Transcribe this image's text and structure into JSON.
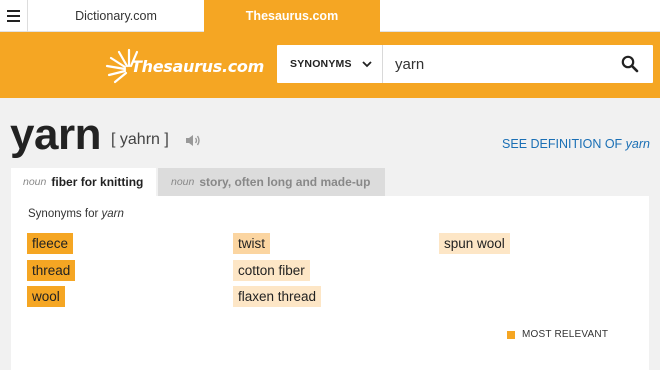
{
  "top_tabs": {
    "dictionary": "Dictionary.com",
    "thesaurus": "Thesaurus.com"
  },
  "logo": {
    "text": "Thesaurus.com"
  },
  "search": {
    "mode_label": "SYNONYMS",
    "query": "yarn"
  },
  "entry": {
    "word": "yarn",
    "pronunciation": "[ yahrn ]",
    "see_definition_prefix": "SEE DEFINITION OF ",
    "see_definition_word": "yarn"
  },
  "senses": [
    {
      "pos": "noun",
      "definition": "fiber for knitting",
      "active": true
    },
    {
      "pos": "noun",
      "definition": "story, often long and made-up",
      "active": false
    }
  ],
  "results": {
    "synonyms_for_prefix": "Synonyms for ",
    "synonyms_for_word": "yarn",
    "synonyms": [
      {
        "word": "fleece",
        "relevance": 3
      },
      {
        "word": "thread",
        "relevance": 3
      },
      {
        "word": "wool",
        "relevance": 3
      },
      {
        "word": "twist",
        "relevance": 2
      },
      {
        "word": "cotton fiber",
        "relevance": 1
      },
      {
        "word": "flaxen thread",
        "relevance": 1
      },
      {
        "word": "spun wool",
        "relevance": 1
      }
    ],
    "legend_label": "MOST RELEVANT"
  },
  "colors": {
    "brand_orange": "#f5a623",
    "link_blue": "#1a6fb5",
    "relevance_high": "#f5a623",
    "relevance_mid": "#fbd5a1",
    "relevance_low": "#fde6c6"
  },
  "icons": [
    "hamburger-menu-icon",
    "thesaurus-logo-sunburst",
    "chevron-down-icon",
    "search-icon",
    "speaker-icon"
  ]
}
